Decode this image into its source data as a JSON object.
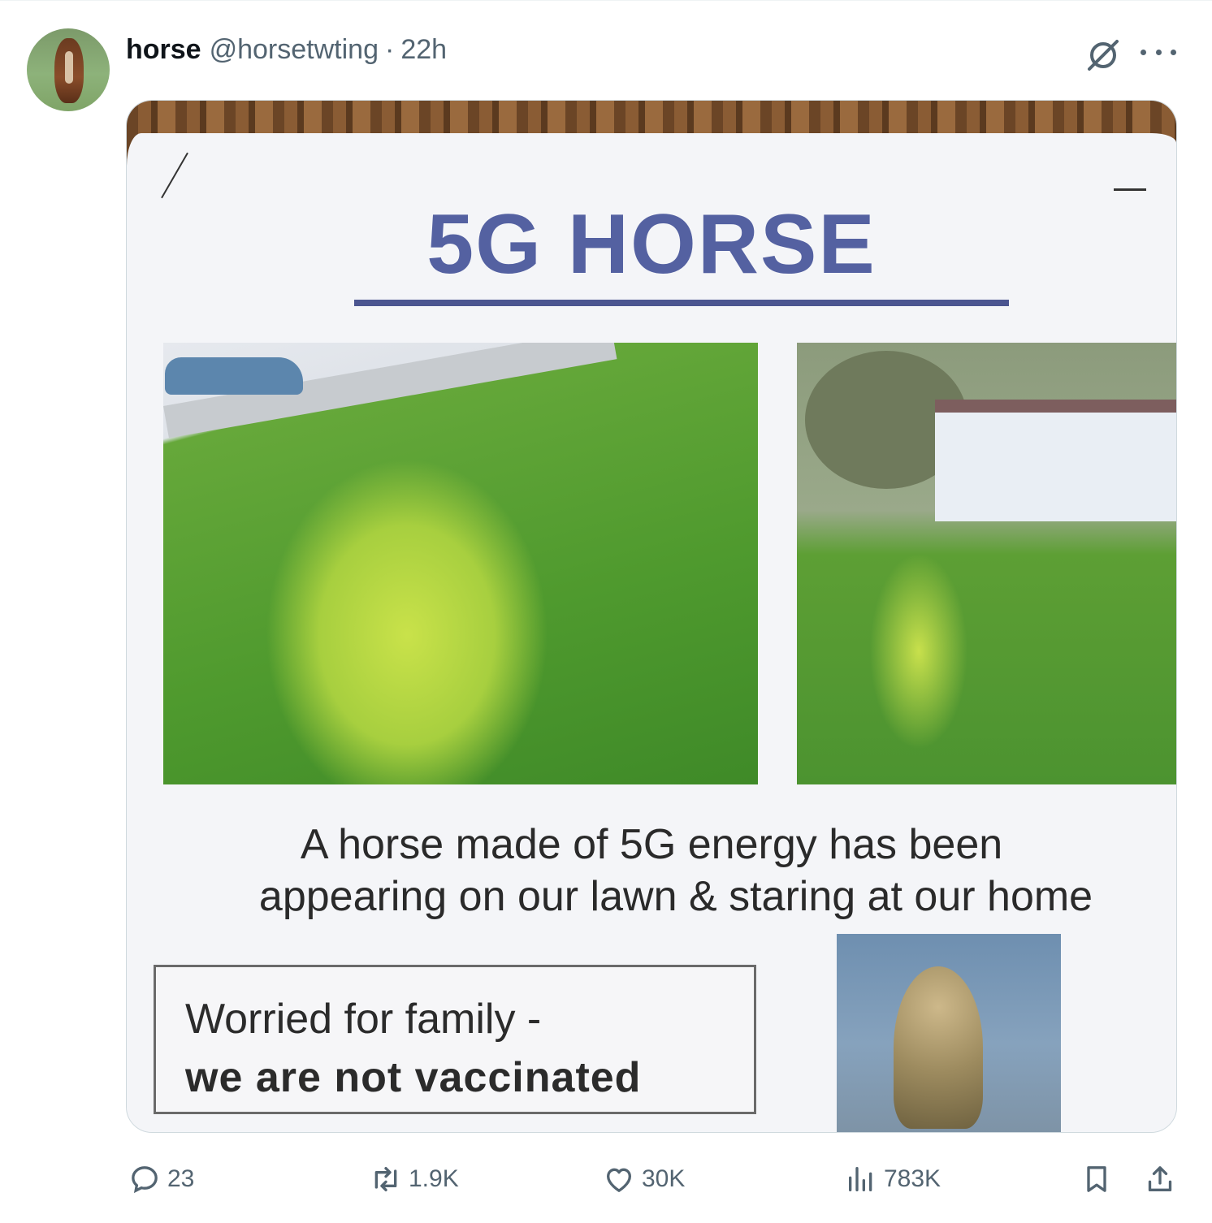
{
  "author": {
    "name": "horse",
    "handle": "@horsetwting",
    "separator": "·",
    "time": "22h"
  },
  "media": {
    "headline": "5G HORSE",
    "caption_line1": "A horse made of 5G energy has been",
    "caption_line2": "appearing on our lawn & staring at our home",
    "box_line1": "Worried for family -",
    "box_line2": "we are not vaccinated"
  },
  "metrics": {
    "replies": "23",
    "reposts": "1.9K",
    "likes": "30K",
    "views": "783K"
  },
  "icons": {
    "header": [
      "grok-icon",
      "more-icon"
    ],
    "actions": [
      "reply-icon",
      "retweet-icon",
      "like-icon",
      "views-icon",
      "bookmark-icon",
      "share-icon"
    ]
  },
  "colors": {
    "text_primary": "#0f1419",
    "text_secondary": "#536471",
    "headline_blue": "#5461a1"
  }
}
